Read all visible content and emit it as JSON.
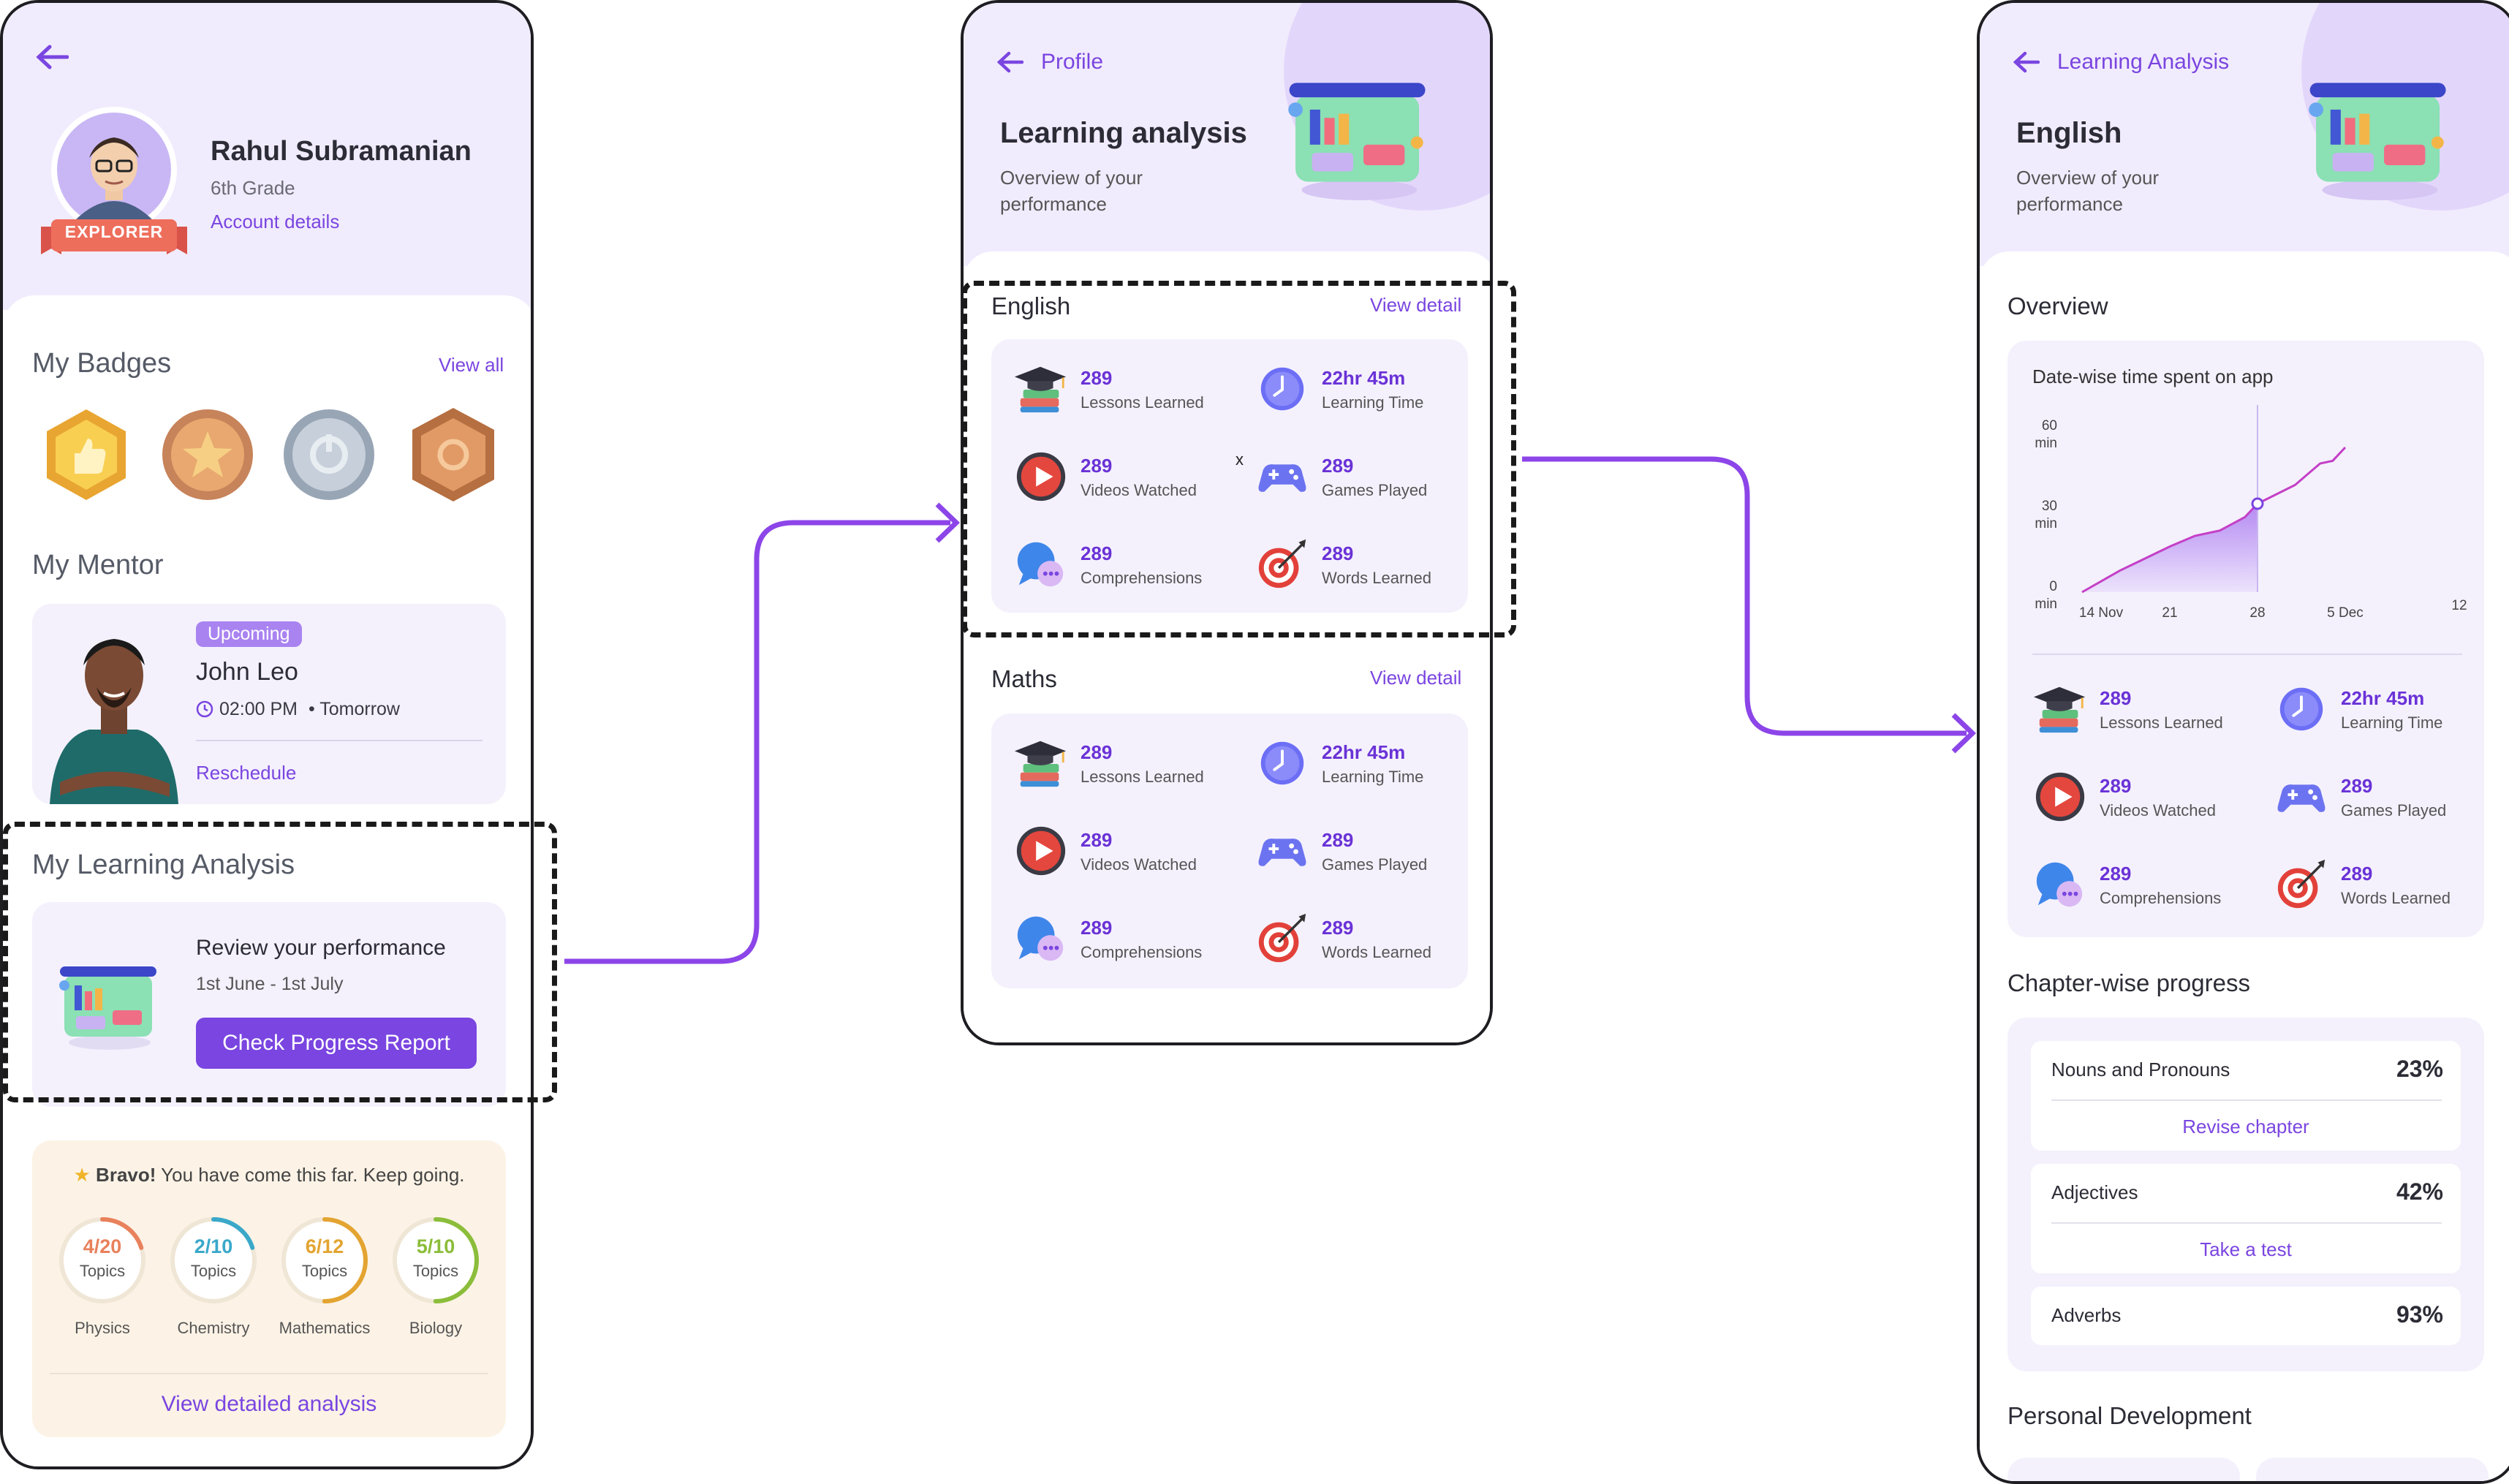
{
  "colors": {
    "accent": "#7a45e0",
    "header_bg": "#f1ecfd",
    "card_bg": "#f4f1fd",
    "bravo_bg": "#fcf3e6"
  },
  "screen1": {
    "name": "Rahul Subramanian",
    "grade": "6th Grade",
    "account_link": "Account details",
    "rank_badge": "EXPLORER",
    "badges_title": "My Badges",
    "badges_link": "View all",
    "mentor_title": "My Mentor",
    "mentor_status": "Upcoming",
    "mentor_name": "John Leo",
    "mentor_time": "02:00 PM",
    "mentor_day": "• Tomorrow",
    "mentor_action": "Reschedule",
    "analysis_title": "My Learning Analysis",
    "review_title": "Review your performance",
    "review_dates": "1st June - 1st July",
    "check_button": "Check Progress Report",
    "bravo_bold": "Bravo!",
    "bravo_text": "You have come this far. Keep going.",
    "subjects": [
      {
        "value": "4/20",
        "unit": "Topics",
        "name": "Physics",
        "color": "#e8815c",
        "fraction": 0.2
      },
      {
        "value": "2/10",
        "unit": "Topics",
        "name": "Chemistry",
        "color": "#3aa8c9",
        "fraction": 0.2
      },
      {
        "value": "6/12",
        "unit": "Topics",
        "name": "Mathematics",
        "color": "#e3a431",
        "fraction": 0.5
      },
      {
        "value": "5/10",
        "unit": "Topics",
        "name": "Biology",
        "color": "#8bbd3a",
        "fraction": 0.5
      }
    ],
    "detail_link": "View detailed analysis"
  },
  "screen2": {
    "back_label": "Profile",
    "title": "Learning analysis",
    "subtitle_line1": "Overview of your",
    "subtitle_line2": "performance",
    "sections": [
      {
        "title": "English",
        "link": "View detail",
        "stats": [
          {
            "value": "289",
            "label": "Lessons Learned",
            "icon": "graduation-icon"
          },
          {
            "value": "22hr 45m",
            "label": "Learning Time",
            "icon": "clock-icon"
          },
          {
            "value": "289",
            "label": "Videos Watched",
            "icon": "play-icon"
          },
          {
            "value": "289",
            "label": "Games Played",
            "icon": "gamepad-icon"
          },
          {
            "value": "289",
            "label": "Comprehensions",
            "icon": "chat-icon"
          },
          {
            "value": "289",
            "label": "Words Learned",
            "icon": "target-icon"
          }
        ]
      },
      {
        "title": "Maths",
        "link": "View detail",
        "stats": [
          {
            "value": "289",
            "label": "Lessons Learned",
            "icon": "graduation-icon"
          },
          {
            "value": "22hr 45m",
            "label": "Learning Time",
            "icon": "clock-icon"
          },
          {
            "value": "289",
            "label": "Videos Watched",
            "icon": "play-icon"
          },
          {
            "value": "289",
            "label": "Games Played",
            "icon": "gamepad-icon"
          },
          {
            "value": "289",
            "label": "Comprehensions",
            "icon": "chat-icon"
          },
          {
            "value": "289",
            "label": "Words Learned",
            "icon": "target-icon"
          }
        ]
      }
    ]
  },
  "screen3": {
    "back_label": "Learning Analysis",
    "title": "English",
    "subtitle_line1": "Overview of your",
    "subtitle_line2": "performance",
    "overview_title": "Overview",
    "chart_title": "Date-wise time spent on app",
    "stats": [
      {
        "value": "289",
        "label": "Lessons Learned",
        "icon": "graduation-icon"
      },
      {
        "value": "22hr 45m",
        "label": "Learning Time",
        "icon": "clock-icon"
      },
      {
        "value": "289",
        "label": "Videos Watched",
        "icon": "play-icon"
      },
      {
        "value": "289",
        "label": "Games Played",
        "icon": "gamepad-icon"
      },
      {
        "value": "289",
        "label": "Comprehensions",
        "icon": "chat-icon"
      },
      {
        "value": "289",
        "label": "Words Learned",
        "icon": "target-icon"
      }
    ],
    "chapters_title": "Chapter-wise progress",
    "chapters": [
      {
        "name": "Nouns and Pronouns",
        "percent": "23%",
        "action": "Revise chapter"
      },
      {
        "name": "Adjectives",
        "percent": "42%",
        "action": "Take a test"
      },
      {
        "name": "Adverbs",
        "percent": "93%",
        "action": ""
      }
    ],
    "personal_title": "Personal Development"
  },
  "chart_data": {
    "type": "area",
    "title": "Date-wise time spent on app",
    "x_ticks": [
      "14 Nov",
      "21",
      "28",
      "5 Dec",
      "12"
    ],
    "y_ticks": [
      {
        "value": 60,
        "label": "60",
        "unit": "min"
      },
      {
        "value": 30,
        "label": "30",
        "unit": "min"
      },
      {
        "value": 0,
        "label": "0",
        "unit": "min"
      }
    ],
    "ylim": [
      0,
      60
    ],
    "points": [
      [
        0,
        0
      ],
      [
        3,
        8
      ],
      [
        7,
        17
      ],
      [
        9,
        21
      ],
      [
        11,
        23
      ],
      [
        13,
        28
      ],
      [
        14,
        33
      ],
      [
        17,
        40
      ],
      [
        18,
        44
      ],
      [
        19,
        48
      ],
      [
        20,
        49
      ],
      [
        21,
        54
      ]
    ],
    "highlight_index": 6,
    "grid": false
  }
}
